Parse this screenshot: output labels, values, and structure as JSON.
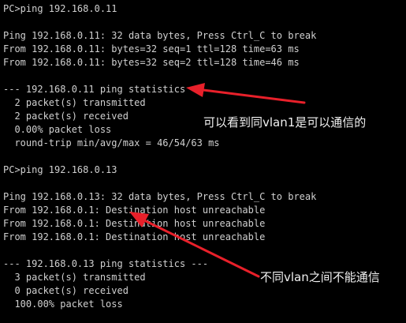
{
  "terminal": {
    "lines": [
      "PC>ping 192.168.0.11",
      "",
      "Ping 192.168.0.11: 32 data bytes, Press Ctrl_C to break",
      "From 192.168.0.11: bytes=32 seq=1 ttl=128 time=63 ms",
      "From 192.168.0.11: bytes=32 seq=2 ttl=128 time=46 ms",
      "",
      "--- 192.168.0.11 ping statistics ---",
      "  2 packet(s) transmitted",
      "  2 packet(s) received",
      "  0.00% packet loss",
      "  round-trip min/avg/max = 46/54/63 ms",
      "",
      "PC>ping 192.168.0.13",
      "",
      "Ping 192.168.0.13: 32 data bytes, Press Ctrl_C to break",
      "From 192.168.0.1: Destination host unreachable",
      "From 192.168.0.1: Destination host unreachable",
      "From 192.168.0.1: Destination host unreachable",
      "",
      "--- 192.168.0.13 ping statistics ---",
      "  3 packet(s) transmitted",
      "  0 packet(s) received",
      "  100.00% packet loss"
    ]
  },
  "annotations": {
    "same_vlan_note": "可以看到同vlan1是可以通信的",
    "diff_vlan_note": "不同vlan之间不能通信"
  },
  "colors": {
    "background": "#000000",
    "terminal_text": "#d0d0d0",
    "annotation_text": "#f0f0f0",
    "arrow": "#e8202a"
  }
}
